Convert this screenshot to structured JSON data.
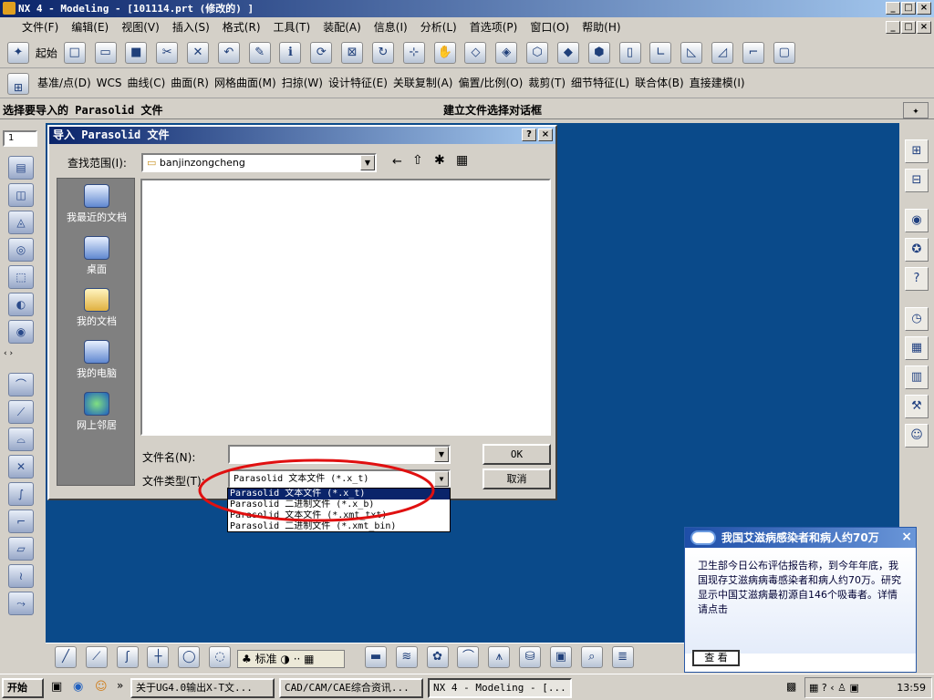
{
  "window": {
    "title": "NX 4 - Modeling - [101114.prt (修改的) ]"
  },
  "menu": [
    "文件(F)",
    "编辑(E)",
    "视图(V)",
    "插入(S)",
    "格式(R)",
    "工具(T)",
    "装配(A)",
    "信息(I)",
    "分析(L)",
    "首选项(P)",
    "窗口(O)",
    "帮助(H)"
  ],
  "toolbar": {
    "start_label": "起始"
  },
  "toolbar2": [
    "基准/点(D)",
    "WCS",
    "曲线(C)",
    "曲面(R)",
    "网格曲面(M)",
    "扫掠(W)",
    "设计特征(E)",
    "关联复制(A)",
    "偏置/比例(O)",
    "裁剪(T)",
    "细节特征(L)",
    "联合体(B)",
    "直接建模(I)"
  ],
  "cue": {
    "left": "选择要导入的 Parasolid 文件",
    "right": "建立文件选择对话框"
  },
  "layer_value": "1",
  "dialog": {
    "title": "导入 Parasolid 文件",
    "help_btn": "?",
    "close_btn": "×",
    "look_in_label": "查找范围(I):",
    "look_in_value": "banjinzongcheng",
    "places": [
      "我最近的文档",
      "桌面",
      "我的文档",
      "我的电脑",
      "网上邻居"
    ],
    "filename_label": "文件名(N):",
    "filename_value": "",
    "filetype_label": "文件类型(T):",
    "filetype_value": "Parasolid 文本文件 (*.x_t)",
    "ok_label": "OK",
    "cancel_label": "取消",
    "filetype_options": [
      "Parasolid 文本文件 (*.x_t)",
      "Parasolid 二进制文件 (*.x_b)",
      "Parasolid 文本文件 (*.xmt_txt)",
      "Parasolid 二进制文件 (*.xmt_bin)"
    ]
  },
  "popup": {
    "title": "我国艾滋病感染者和病人约70万",
    "body": "卫生部今日公布评估报告称，到今年年底，我国现存艾滋病病毒感染者和病人约70万。研究显示中国艾滋病最初源自146个吸毒者。详情请点击",
    "button": "查 看"
  },
  "taskbar": {
    "start": "开始",
    "tasks": [
      "关于UG4.0输出X-T文...",
      "CAD/CAM/CAE综合资讯...",
      "NX 4 - Modeling - [..."
    ],
    "ime": "标准",
    "clock": "13:59"
  },
  "colors": {
    "graphics_bg": "#0a4a8a",
    "title_bg": "#0a246a",
    "highlight_ellipse": "#e01010"
  }
}
